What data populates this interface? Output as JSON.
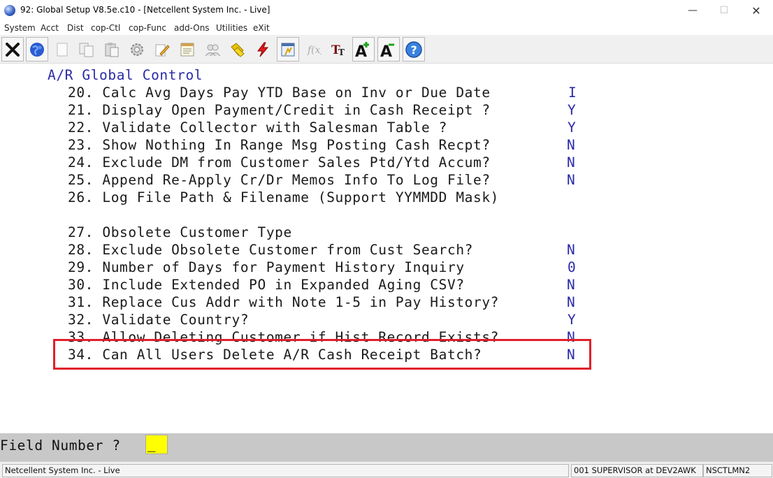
{
  "window": {
    "title": "92: Global Setup V8.5e.c10 - [Netcellent System Inc. - Live]",
    "minimize_glyph": "—",
    "maximize_glyph": "☐",
    "close_glyph": "✕"
  },
  "menu": [
    "System",
    "Acct",
    "Dist",
    "cop-Ctl",
    "cop-Func",
    "add-Ons",
    "Utilities",
    "eXit"
  ],
  "toolbar": {
    "icons": [
      "exit-icon",
      "globe-icon",
      "blank-icon",
      "copy-icon",
      "paste-icon",
      "settings-icon",
      "edit-icon",
      "notepad-icon",
      "users-icon",
      "tags-icon",
      "lightning-icon",
      "report-icon",
      "function-icon",
      "font-size-icon",
      "increase-font-icon",
      "decrease-font-icon",
      "help-icon"
    ]
  },
  "screen": {
    "heading": "A/R Global Control",
    "lines": [
      {
        "num": "20.",
        "text": "Calc Avg Days Pay YTD Base on Inv or Due Date",
        "value": "I"
      },
      {
        "num": "21.",
        "text": "Display Open Payment/Credit in Cash Receipt ?",
        "value": "Y"
      },
      {
        "num": "22.",
        "text": "Validate Collector with Salesman Table ?",
        "value": "Y"
      },
      {
        "num": "23.",
        "text": "Show Nothing In Range Msg Posting Cash Recpt?",
        "value": "N"
      },
      {
        "num": "24.",
        "text": "Exclude DM from Customer Sales Ptd/Ytd Accum?",
        "value": "N"
      },
      {
        "num": "25.",
        "text": "Append Re-Apply Cr/Dr Memos Info To Log File?",
        "value": "N"
      },
      {
        "num": "26.",
        "text": "Log File Path & Filename (Support YYMMDD Mask)",
        "value": ""
      },
      {
        "num": "27.",
        "text": "Obsolete Customer Type",
        "value": ""
      },
      {
        "num": "28.",
        "text": "Exclude Obsolete Customer from Cust Search?",
        "value": "N"
      },
      {
        "num": "29.",
        "text": "Number of Days for Payment History Inquiry",
        "value": "0"
      },
      {
        "num": "30.",
        "text": "Include Extended PO in Expanded Aging CSV?",
        "value": "N"
      },
      {
        "num": "31.",
        "text": "Replace Cus Addr with Note 1-5 in Pay History?",
        "value": "N"
      },
      {
        "num": "32.",
        "text": "Validate Country?",
        "value": "Y"
      },
      {
        "num": "33.",
        "text": "Allow Deleting Customer if Hist Record Exists?",
        "value": "N"
      },
      {
        "num": "34.",
        "text": "Can All Users Delete A/R Cash Receipt Batch?",
        "value": "N"
      }
    ]
  },
  "prompt": {
    "label": "Field Number ?",
    "value": "_"
  },
  "status": {
    "company": "Netcellent System Inc. - Live",
    "user": "001 SUPERVISOR at DEV2AWK",
    "terminal": "NSCTLMN2"
  }
}
